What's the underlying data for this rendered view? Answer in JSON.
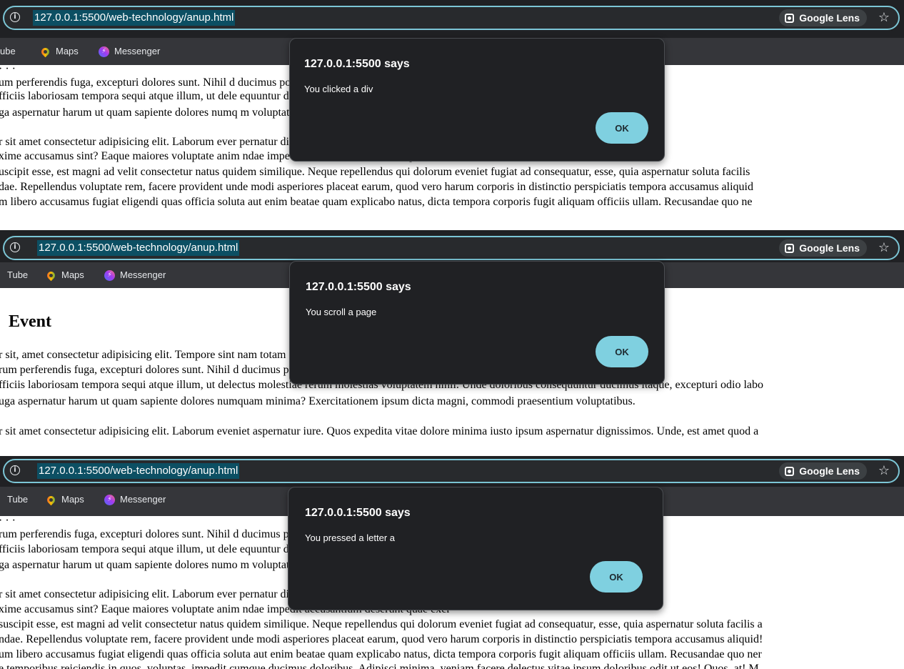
{
  "browser": {
    "url": "127.0.0.1:5500/web-technology/anup.html",
    "google_lens_label": "Google Lens",
    "bookmarks": [
      "Tube",
      "Maps",
      "Messenger"
    ],
    "bookmarks_first": [
      "ube",
      "Maps",
      "Messenger"
    ]
  },
  "page": {
    "heading": "Event"
  },
  "dialogs": [
    {
      "title": "127.0.0.1:5500 says",
      "message": "You clicked a div",
      "ok_label": "OK"
    },
    {
      "title": "127.0.0.1:5500 says",
      "message": "You scroll a page",
      "ok_label": "OK"
    },
    {
      "title": "127.0.0.1:5500 says",
      "message": "You pressed a letter a",
      "ok_label": "OK"
    }
  ],
  "panel1_lines": [
    "um perferendis fuga, excepturi dolores sunt. Nihil d                                                                                           ducimus possimus voluptatum quo unde re",
    "fficiis laboriosam tempora sequi atque illum, ut dele                                                                                      equuntur ducimus itaque, excepturi odio lab",
    "ga aspernatur harum ut quam sapiente dolores numq                                                                                         m voluptatibus.",
    "",
    "r sit amet consectetur adipisicing elit. Laborum ever                                                                                        pernatur dignissimos. Unde, est amet quod a",
    "xime accusamus sint? Eaque maiores voluptate anim                                                                                          ndae impedit accusantium deserunt quae ex",
    "uscipit esse, est magni ad velit consectetur natus quidem similique. Neque repellendus qui dolorum eveniet fugiat ad consequatur, esse, quia aspernatur soluta facilis",
    "dae. Repellendus voluptate rem, facere provident unde modi asperiores placeat earum, quod vero harum corporis in distinctio perspiciatis tempora accusamus aliquid",
    "m libero accusamus fugiat eligendi quas officia soluta aut enim beatae quam explicabo natus, dicta tempora corporis fugit aliquam officiis ullam. Recusandae quo ne"
  ],
  "panel2_lines": [
    "r sit, amet consectetur adipisicing elit. Tempore sint                                                                                       nam totam distinctio reprehenderit in enim",
    "rum perferendis fuga, excepturi dolores sunt. Nihil d                                                                                        ducimus possimus voluptatum quo unde re",
    "fficiis laboriosam tempora sequi atque illum, ut delectus molestiae rerum molestias voluptatem nihil. Unde doloribus consequuntur ducimus itaque, excepturi odio labo",
    "uga aspernatur harum ut quam sapiente dolores numquam minima? Exercitationem ipsum dicta magni, commodi praesentium voluptatibus.",
    "",
    "r sit amet consectetur adipisicing elit. Laborum eveniet aspernatur iure. Quos expedita vitae dolore minima iusto ipsum aspernatur dignissimos. Unde, est amet quod a"
  ],
  "panel3_lines": [
    "rum perferendis fuga, excepturi dolores sunt. Nihil d                                                                                        ducimus possimus voluptatum quo unde rei",
    "fficiis laboriosam tempora sequi atque illum, ut dele                                                                                      equuntur ducimus itaque, excepturi odio labo",
    "ga aspernatur harum ut quam sapiente dolores numo                                                                                        m voluptatibus.",
    "",
    "r sit amet consectetur adipisicing elit. Laborum ever                                                                                        pernatur dignissimos. Unde, est amet quod al",
    "xime accusamus sint? Eaque maiores voluptate anim                                                                                          ndae impedit accusantium deserunt quae exer",
    "suscipit esse, est magni ad velit consectetur natus quidem similique. Neque repellendus qui dolorum eveniet fugiat ad consequatur, esse, quia aspernatur soluta facilis a",
    "ndae. Repellendus voluptate rem, facere provident unde modi asperiores placeat earum, quod vero harum corporis in distinctio perspiciatis tempora accusamus aliquid!",
    "um libero accusamus fugiat eligendi quas officia soluta aut enim beatae quam explicabo natus, dicta tempora corporis fugit aliquam officiis ullam. Recusandae quo ner",
    "e temporibus reiciendis in quos, voluptas, impedit cumque ducimus doloribus. Adipisci minima, veniam facere delectus vitae ipsum doloribus odit ut eos! Quos, at! M"
  ]
}
